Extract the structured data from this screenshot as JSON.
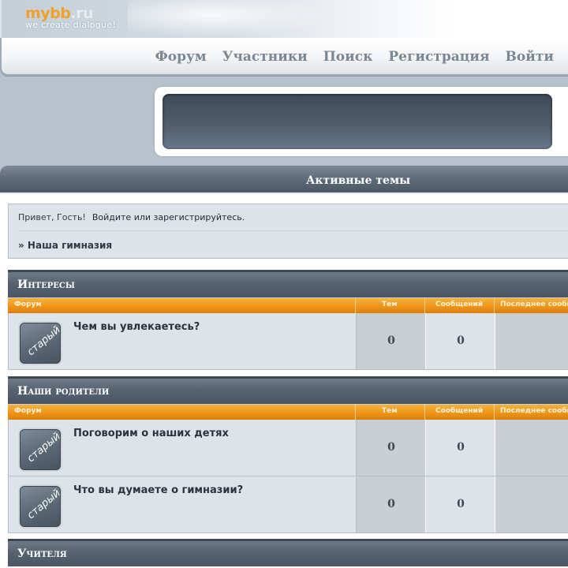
{
  "logo": {
    "main_a": "mybb",
    "main_b": ".ru",
    "tagline": "we create dialogue!"
  },
  "nav": [
    {
      "label": "Форум"
    },
    {
      "label": "Участники"
    },
    {
      "label": "Поиск"
    },
    {
      "label": "Регистрация"
    },
    {
      "label": "Войти"
    }
  ],
  "active_topics": {
    "title": "Активные темы"
  },
  "welcome": {
    "greeting": "Привет, Гость!",
    "login_text": "Войдите или зарегистрируйтесь.",
    "breadcrumb": "» Наша гимназия"
  },
  "columns": {
    "forum": "Форум",
    "topics": "Тем",
    "posts": "Сообщений",
    "last": "Последнее сообщ"
  },
  "categories": [
    {
      "title": "Интересы",
      "forums": [
        {
          "icon_label": "старый",
          "name": "Чем вы увлекаетесь?",
          "topics": "0",
          "posts": "0"
        }
      ]
    },
    {
      "title": "Наши родители",
      "forums": [
        {
          "icon_label": "старый",
          "name": "Поговорим о наших детях",
          "topics": "0",
          "posts": "0"
        },
        {
          "icon_label": "старый",
          "name": "Что вы думаете о гимназии?",
          "topics": "0",
          "posts": "0"
        }
      ]
    },
    {
      "title": "Учителя",
      "forums": []
    }
  ],
  "colors": {
    "accent": "#ee9216",
    "header_dark": "#566371",
    "row_bg": "#dde3e9"
  }
}
